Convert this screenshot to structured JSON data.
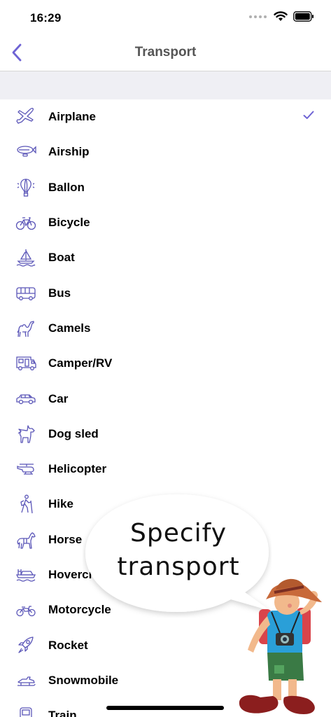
{
  "status_bar": {
    "time": "16:29"
  },
  "nav": {
    "title": "Transport"
  },
  "list": [
    {
      "label": "Airplane",
      "icon": "airplane-icon",
      "selected": true
    },
    {
      "label": "Airship",
      "icon": "airship-icon"
    },
    {
      "label": "Ballon",
      "icon": "balloon-icon"
    },
    {
      "label": "Bicycle",
      "icon": "bicycle-icon"
    },
    {
      "label": "Boat",
      "icon": "boat-icon"
    },
    {
      "label": "Bus",
      "icon": "bus-icon"
    },
    {
      "label": "Camels",
      "icon": "camel-icon"
    },
    {
      "label": "Camper/RV",
      "icon": "camper-icon"
    },
    {
      "label": "Car",
      "icon": "car-icon"
    },
    {
      "label": "Dog sled",
      "icon": "dog-icon"
    },
    {
      "label": "Helicopter",
      "icon": "helicopter-icon"
    },
    {
      "label": "Hike",
      "icon": "hiker-icon"
    },
    {
      "label": "Horse",
      "icon": "horse-icon"
    },
    {
      "label": "Hovercraft",
      "icon": "hovercraft-icon"
    },
    {
      "label": "Motorcycle",
      "icon": "motorcycle-icon"
    },
    {
      "label": "Rocket",
      "icon": "rocket-icon"
    },
    {
      "label": "Snowmobile",
      "icon": "snowmobile-icon"
    },
    {
      "label": "Train",
      "icon": "train-icon"
    }
  ],
  "bubble": {
    "line1": "Specify",
    "line2": "transport"
  },
  "colors": {
    "accent": "#6e63d4",
    "icon": "#5b56b8",
    "separator": "#efeff4"
  }
}
